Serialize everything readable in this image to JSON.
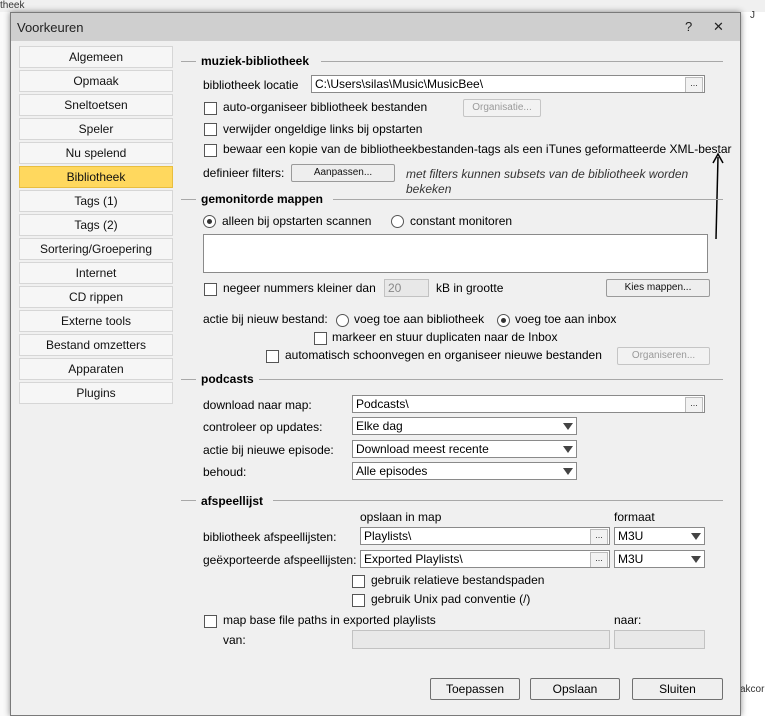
{
  "background": {
    "top_left_text": "theek",
    "top_right_text": "J",
    "right_text": "akcor"
  },
  "window": {
    "title": "Voorkeuren",
    "help_label": "?",
    "close_label": "✕"
  },
  "sidebar": {
    "items": [
      {
        "label": "Algemeen"
      },
      {
        "label": "Opmaak"
      },
      {
        "label": "Sneltoetsen"
      },
      {
        "label": "Speler"
      },
      {
        "label": "Nu spelend"
      },
      {
        "label": "Bibliotheek"
      },
      {
        "label": "Tags (1)"
      },
      {
        "label": "Tags (2)"
      },
      {
        "label": "Sortering/Groepering"
      },
      {
        "label": "Internet"
      },
      {
        "label": "CD rippen"
      },
      {
        "label": "Externe tools"
      },
      {
        "label": "Bestand omzetters"
      },
      {
        "label": "Apparaten"
      },
      {
        "label": "Plugins"
      }
    ],
    "active_index": 5,
    "active_color": "#ffd85e"
  },
  "library": {
    "title": "muziek-bibliotheek",
    "location_label": "bibliotheek locatie",
    "location_value": "C:\\Users\\silas\\Music\\MusicBee\\",
    "browse_label": "...",
    "auto_organize_label": "auto-organiseer bibliotheek bestanden",
    "organize_button": "Organisatie...",
    "remove_links_label": "verwijder ongeldige links bij opstarten",
    "itunes_copy_label": "bewaar een kopie van de bibliotheekbestanden-tags als een iTunes geformatteerde XML-bestar",
    "filters_label": "definieer filters:",
    "filters_button": "Aanpassen...",
    "filters_hint_line1": "met filters kunnen subsets van de bibliotheek worden",
    "filters_hint_line2": "bekeken"
  },
  "monitored": {
    "title": "gemonitorde mappen",
    "radio_startup": "alleen bij opstarten scannen",
    "radio_constant": "constant monitoren",
    "ignore_label": "negeer nummers kleiner dan",
    "ignore_value": "20",
    "ignore_unit": "kB in grootte",
    "choose_button": "Kies mappen...",
    "action_label": "actie bij nieuw bestand:",
    "radio_add_library": "voeg toe aan bibliotheek",
    "radio_add_inbox": "voeg toe aan inbox",
    "mark_duplicates_label": "markeer en stuur duplicaten naar de Inbox",
    "auto_clean_label": "automatisch schoonvegen en organiseer nieuwe bestanden",
    "organize_button": "Organiseren..."
  },
  "podcasts": {
    "title": "podcasts",
    "download_label": "download naar map:",
    "download_value": "Podcasts\\",
    "browse_label": "...",
    "updates_label": "controleer op updates:",
    "updates_value": "Elke dag",
    "episode_label": "actie bij nieuwe episode:",
    "episode_value": "Download meest recente",
    "keep_label": "behoud:",
    "keep_value": "Alle episodes"
  },
  "playlists": {
    "title": "afspeellijst",
    "save_in_folder_header": "opslaan in map",
    "format_header": "formaat",
    "library_label": "bibliotheek afspeellijsten:",
    "library_value": "Playlists\\",
    "library_format": "M3U",
    "exported_label": "geëxporteerde afspeellijsten:",
    "exported_value": "Exported Playlists\\",
    "exported_format": "M3U",
    "browse_label": "...",
    "relative_paths_label": "gebruik relatieve bestandspaden",
    "unix_label": "gebruik Unix pad conventie (/)",
    "map_base_label": "map base file paths in exported playlists",
    "to_label": "naar:",
    "from_label": "van:"
  },
  "footer": {
    "apply_label": "Toepassen",
    "save_label": "Opslaan",
    "close_label": "Sluiten"
  }
}
